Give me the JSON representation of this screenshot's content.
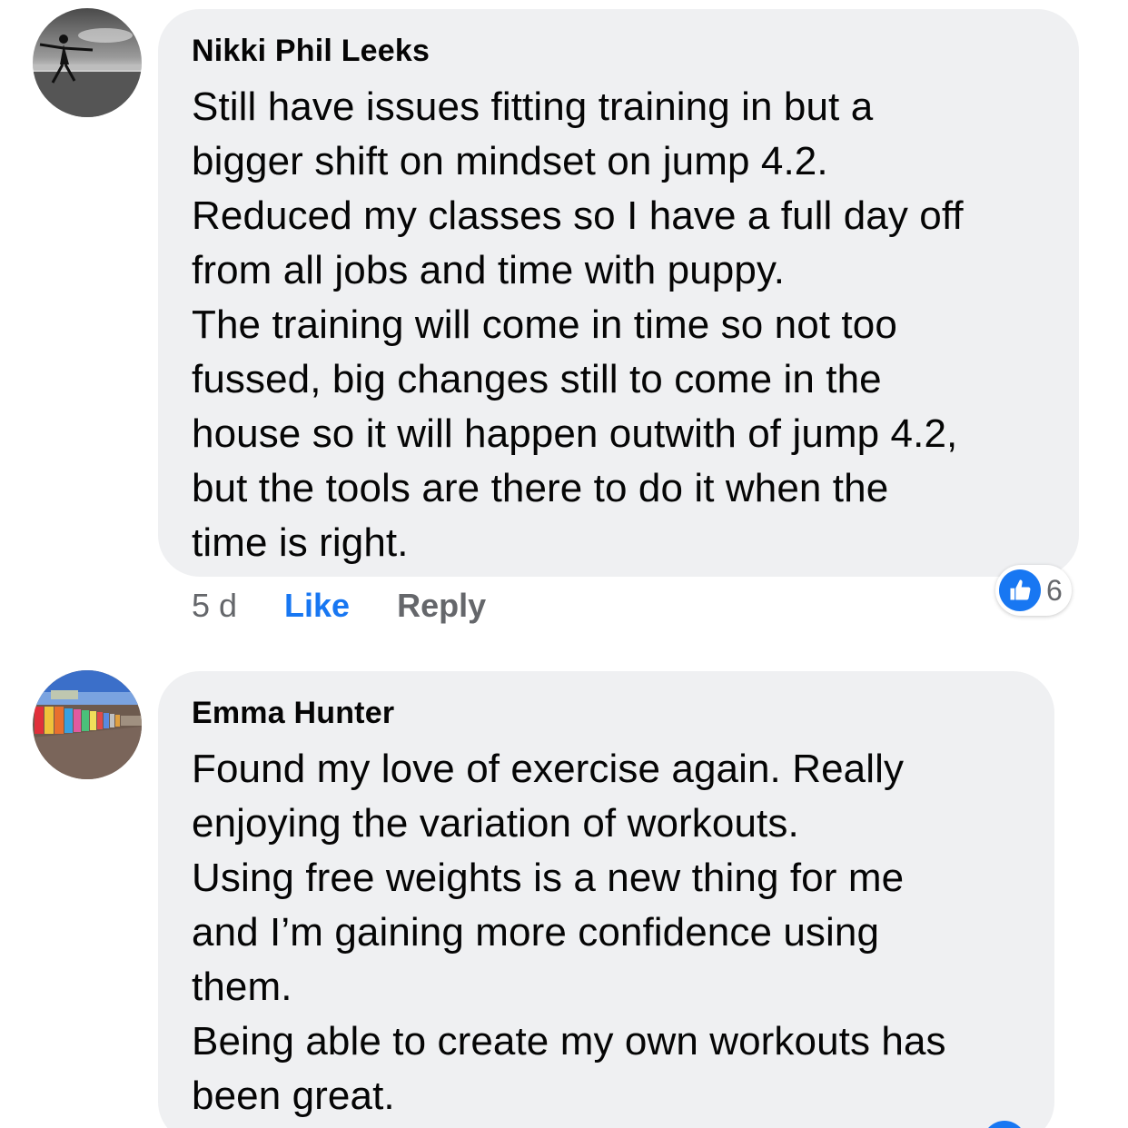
{
  "comments": [
    {
      "author": "Nikki Phil Leeks",
      "lines": [
        "Still have issues fitting training in but a",
        "bigger shift on mindset on jump 4.2.",
        "Reduced my classes so I have a full day off",
        "from all jobs and time with puppy.",
        "The training will come in time so not too",
        "fussed, big changes still to come in the",
        "house so it will happen outwith of jump 4.2,",
        "but the tools are there to do it when the",
        "time is right."
      ],
      "time": "5 d",
      "like_label": "Like",
      "reply_label": "Reply",
      "reaction_count": "6",
      "reaction_icon": "thumbs-up-icon",
      "avatar_icon": "dancer-on-beach-avatar"
    },
    {
      "author": "Emma Hunter",
      "lines": [
        "Found my love of exercise again. Really",
        "enjoying the variation of workouts.",
        "Using free weights is a new thing for me",
        "and I’m gaining more confidence using",
        "them.",
        "Being able to create my own workouts has",
        "been great."
      ],
      "avatar_icon": "beach-huts-avatar"
    }
  ],
  "colors": {
    "bubble": "#eff0f2",
    "link_blue": "#1877f2",
    "secondary_text": "#65676b",
    "primary_text": "#050505"
  }
}
